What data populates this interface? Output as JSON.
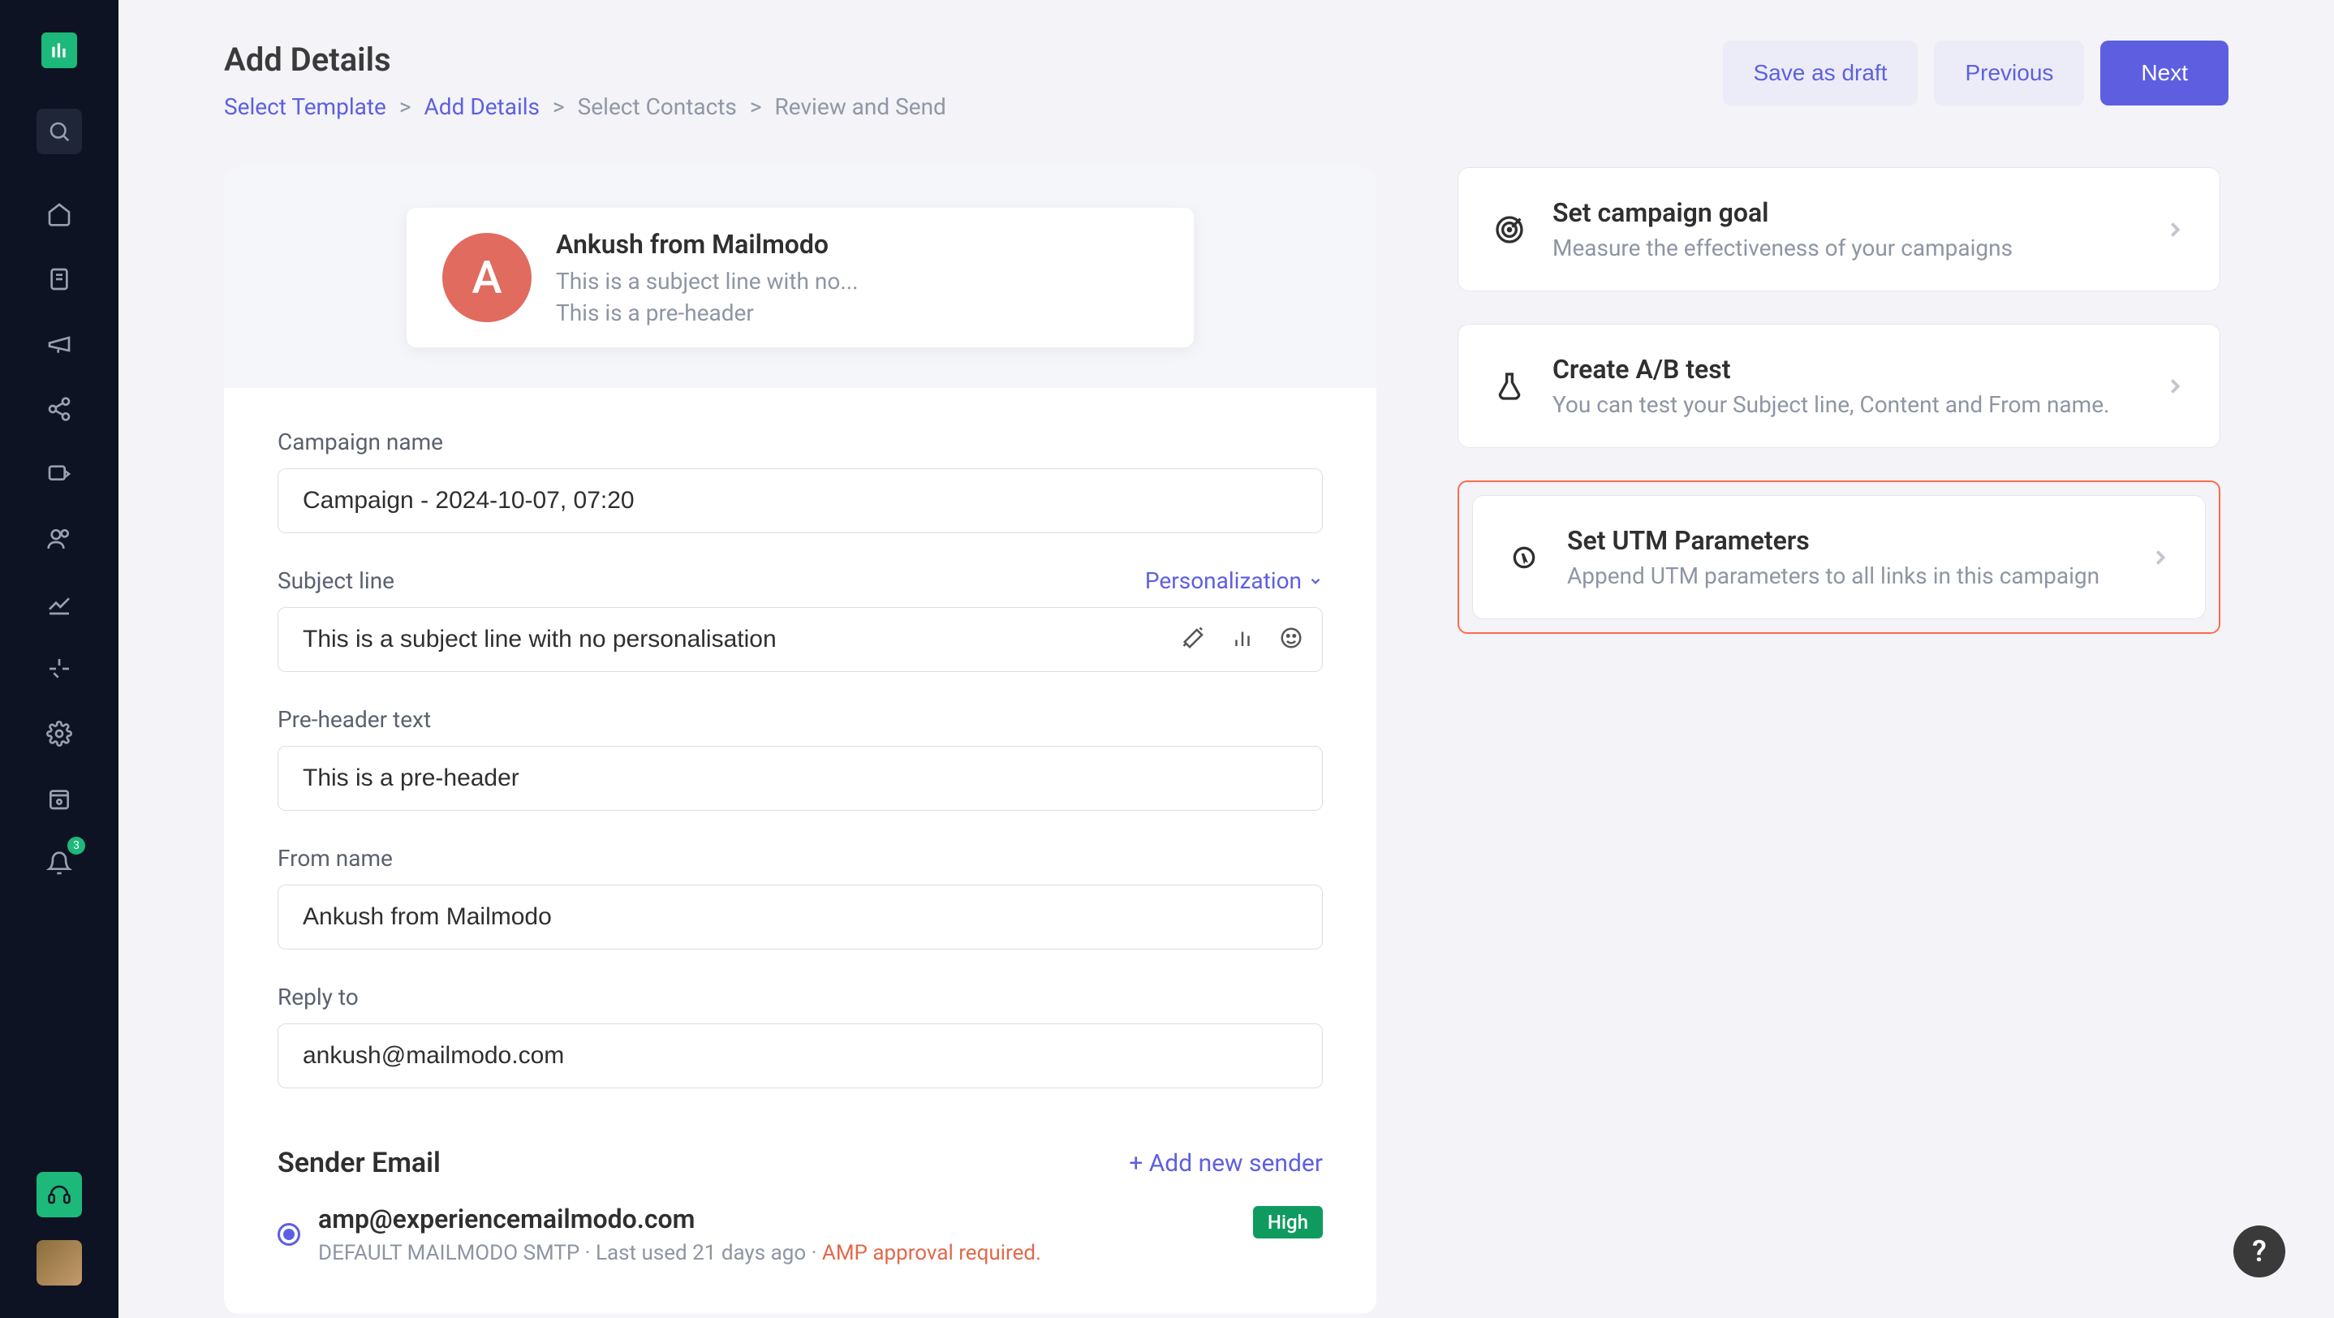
{
  "header": {
    "title": "Add Details",
    "breadcrumb": [
      "Select Template",
      "Add Details",
      "Select Contacts",
      "Review and Send"
    ],
    "active_index": 1,
    "actions": {
      "save_draft": "Save as draft",
      "previous": "Previous",
      "next": "Next"
    }
  },
  "preview": {
    "avatar_letter": "A",
    "from": "Ankush from Mailmodo",
    "subject": "This is a subject line with no...",
    "preheader": "This is a pre-header"
  },
  "form": {
    "campaign_name_label": "Campaign name",
    "campaign_name_value": "Campaign - 2024-10-07, 07:20",
    "subject_label": "Subject line",
    "personalization_label": "Personalization",
    "subject_value": "This is a subject line with no personalisation",
    "preheader_label": "Pre-header text",
    "preheader_value": "This is a pre-header",
    "from_name_label": "From name",
    "from_name_value": "Ankush from Mailmodo",
    "reply_to_label": "Reply to",
    "reply_to_value": "ankush@mailmodo.com",
    "sender_section_title": "Sender Email",
    "add_sender_label": "+ Add new sender",
    "sender_email": "amp@experiencemailmodo.com",
    "sender_badge": "High",
    "sender_meta_smtp": "DEFAULT MAILMODO SMTP",
    "sender_meta_dot1": "·",
    "sender_meta_lastused": "Last used 21 days ago",
    "sender_meta_dot2": "·",
    "sender_meta_warn": "AMP approval required."
  },
  "side_options": [
    {
      "title": "Set campaign goal",
      "desc": "Measure the effectiveness of your campaigns"
    },
    {
      "title": "Create A/B test",
      "desc": "You can test your Subject line, Content and From name."
    },
    {
      "title": "Set UTM Parameters",
      "desc": "Append UTM parameters to all links in this campaign"
    }
  ],
  "sidebar": {
    "notif_count": "3"
  },
  "help": "?"
}
